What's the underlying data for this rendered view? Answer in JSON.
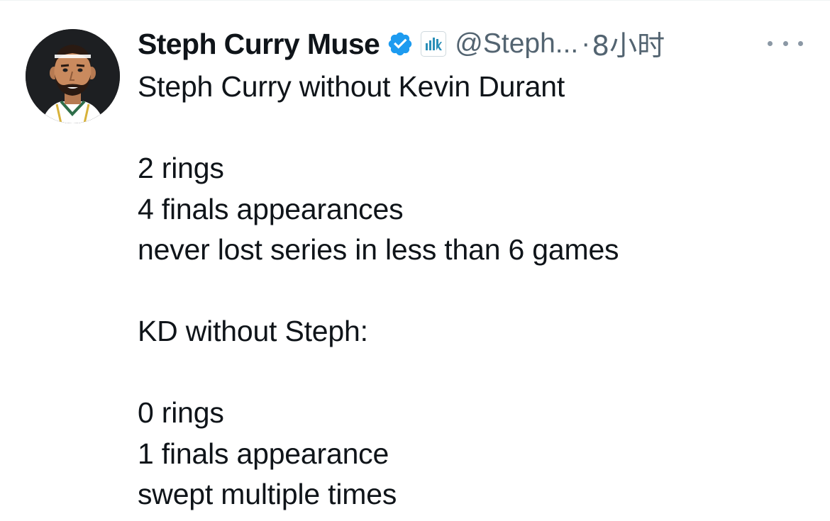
{
  "tweet": {
    "author": {
      "display_name": "Steph Curry Muse",
      "handle": "@Steph...",
      "verified": true,
      "avatar_icon": "cartoon-player-avatar-icon",
      "affiliate_badge_icon": "bar-chart-affiliate-icon"
    },
    "separator": "·",
    "time": "8小时",
    "more_icon": "more-options-icon",
    "lines": [
      "Steph Curry without Kevin Durant",
      "",
      "2 rings",
      "4 finals appearances",
      "never lost series in less than 6 games",
      "",
      "KD without Steph:",
      "",
      "0 rings",
      "1 finals appearance",
      "swept multiple times"
    ]
  },
  "colors": {
    "text_primary": "#0f1419",
    "text_secondary": "#536471",
    "verified_blue": "#1d9bf0",
    "avatar_bg": "#1d1f22"
  }
}
